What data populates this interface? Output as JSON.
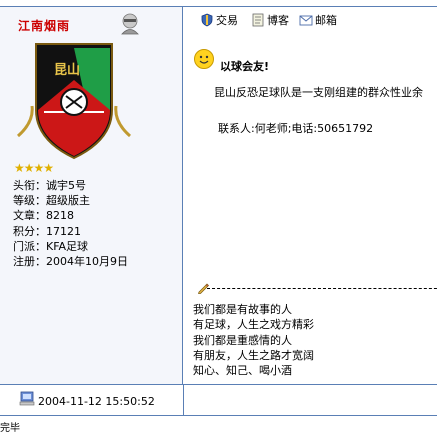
{
  "author": {
    "name": "江南烟雨",
    "stars": "★★★★",
    "info": [
      "头衔：诚宇5号",
      "等级：超级版主",
      "文章：8218",
      "积分：17121",
      "门派：KFA足球",
      "注册：2004年10月9日"
    ],
    "logo_text": "昆山"
  },
  "toolbar": {
    "trade_label": "交易",
    "blog_label": "博客",
    "mail_label": "邮箱"
  },
  "post": {
    "subject": "以球会友!",
    "line1": "昆山反恐足球队是一支刚组建的群众性业余",
    "line2": "联系人:何老师;电话:50651792",
    "signature": [
      "我们都是有故事的人",
      "有足球，人生之戏方精彩",
      "我们都是重感情的人",
      "有朋友，人生之路才宽阔",
      "知心、知己、喝小酒"
    ]
  },
  "footer": {
    "post_time": "2004-11-12 15:50:52",
    "status_fragment": "完毕"
  }
}
